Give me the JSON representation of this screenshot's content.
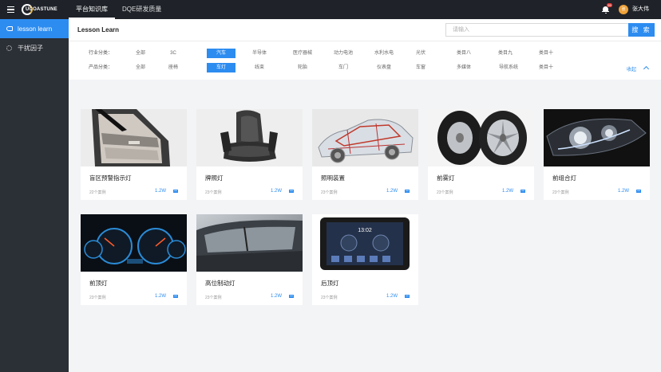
{
  "topbar": {
    "logo_text": "UCOASTUNE",
    "tabs": [
      {
        "label": "平台知识库",
        "active": true
      },
      {
        "label": "DQE研发质量",
        "active": false
      }
    ],
    "notification_count": "99",
    "avatar_text": "张",
    "user_name": "张大伟"
  },
  "sidebar": {
    "items": [
      {
        "label": "lesson learn",
        "icon": "lamp-icon",
        "active": true
      },
      {
        "label": "干扰因子",
        "icon": "gear-icon",
        "active": false
      }
    ]
  },
  "panel": {
    "title": "Lesson Learn",
    "search_placeholder": "请输入",
    "search_button": "搜 索",
    "industry_label": "行业分类：",
    "industry": [
      "全部",
      "3C",
      "汽车",
      "半导体",
      "医疗器械",
      "动力电池",
      "水利水电",
      "光伏",
      "类目八",
      "类目九",
      "类目十"
    ],
    "industry_active": "汽车",
    "product_label": "产品分类：",
    "product": [
      "全部",
      "座椅",
      "车灯",
      "线束",
      "轮胎",
      "车门",
      "仪表盘",
      "车窗",
      "多媒体",
      "导航系统",
      "类目十"
    ],
    "product_active": "车灯",
    "collapse_label": "收起"
  },
  "cards": [
    {
      "title": "盲区预警指示灯",
      "count": "22个案例",
      "views": "1.2W",
      "image": "car-door-interior"
    },
    {
      "title": "牌照灯",
      "count": "23个案例",
      "views": "1.2W",
      "image": "car-seat"
    },
    {
      "title": "照明装置",
      "count": "23个案例",
      "views": "1.2W",
      "image": "car-xray"
    },
    {
      "title": "前雾灯",
      "count": "23个案例",
      "views": "1.2W",
      "image": "tires"
    },
    {
      "title": "前组合灯",
      "count": "23个案例",
      "views": "1.2W",
      "image": "headlight"
    },
    {
      "title": "前顶灯",
      "count": "23个案例",
      "views": "1.2W",
      "image": "dashboard"
    },
    {
      "title": "高位制动灯",
      "count": "23个案例",
      "views": "1.2W",
      "image": "car-window"
    },
    {
      "title": "后顶灯",
      "count": "23个案例",
      "views": "1.2W",
      "image": "multimedia-screen"
    }
  ],
  "screen": {
    "time": "13:02"
  }
}
